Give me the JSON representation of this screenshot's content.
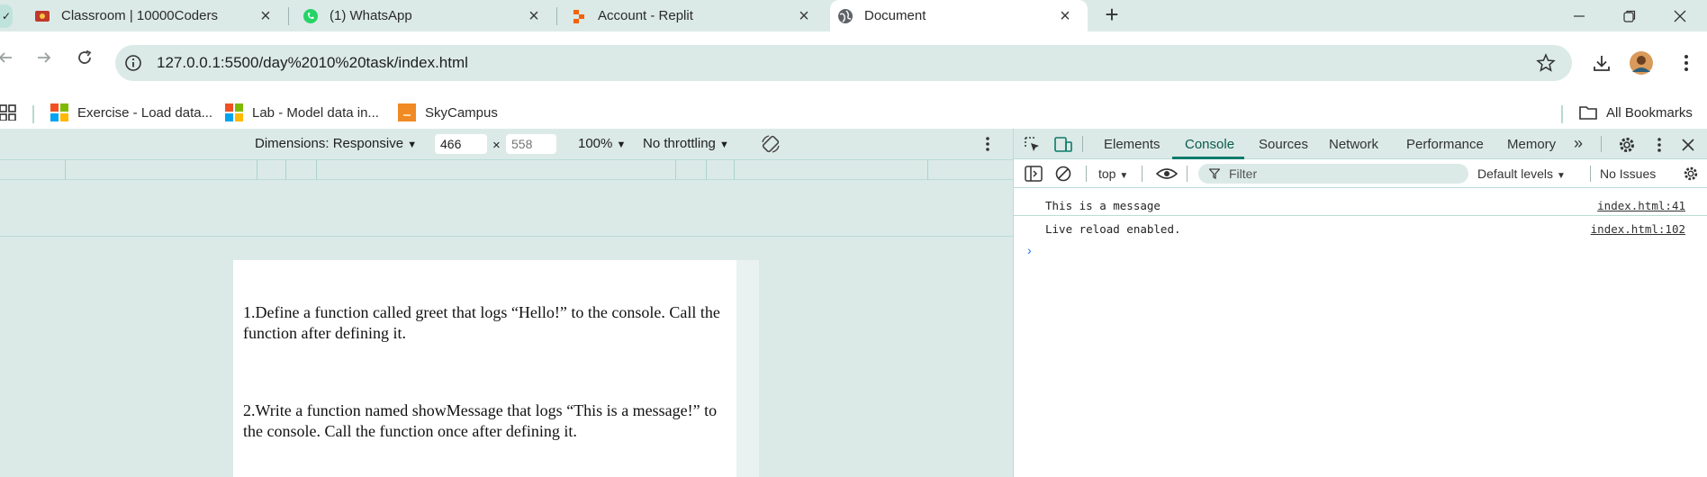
{
  "tabs": [
    {
      "title": "Classroom | 10000Coders",
      "icon": "classroom-icon"
    },
    {
      "title": "(1) WhatsApp",
      "icon": "whatsapp-icon"
    },
    {
      "title": "Account - Replit",
      "icon": "replit-icon"
    },
    {
      "title": "Document",
      "icon": "globe-icon",
      "active": true
    }
  ],
  "address_bar": {
    "url": "127.0.0.1:5500/day%2010%20task/index.html"
  },
  "bookmarks": [
    {
      "label": "Exercise - Load data..."
    },
    {
      "label": "Lab - Model data in..."
    },
    {
      "label": "SkyCampus"
    }
  ],
  "bookmarks_right": "All Bookmarks",
  "device_toolbar": {
    "dimensions": "Dimensions: Responsive",
    "width": "466",
    "height_placeholder": "558",
    "times": "×",
    "zoom": "100%",
    "throttling": "No throttling"
  },
  "page": {
    "para1": "1.Define a function called greet that logs “Hello!” to the console. Call the function after defining it.",
    "para2": "2.Write a function named showMessage that logs “This is a message!” to the console. Call the function once after defining it."
  },
  "devtools": {
    "tabs": [
      "Elements",
      "Console",
      "Sources",
      "Network",
      "Performance",
      "Memory"
    ],
    "active_tab": "Console",
    "context": "top",
    "filter_placeholder": "Filter",
    "levels": "Default levels",
    "issues": "No Issues",
    "logs": [
      {
        "message": "This is a message",
        "source": "index.html:41"
      },
      {
        "message": "Live reload enabled.",
        "source": "index.html:102"
      }
    ],
    "prompt": "›"
  },
  "colors": {
    "accent": "#0b7a6a",
    "chrome_bg": "#dbeae7"
  }
}
